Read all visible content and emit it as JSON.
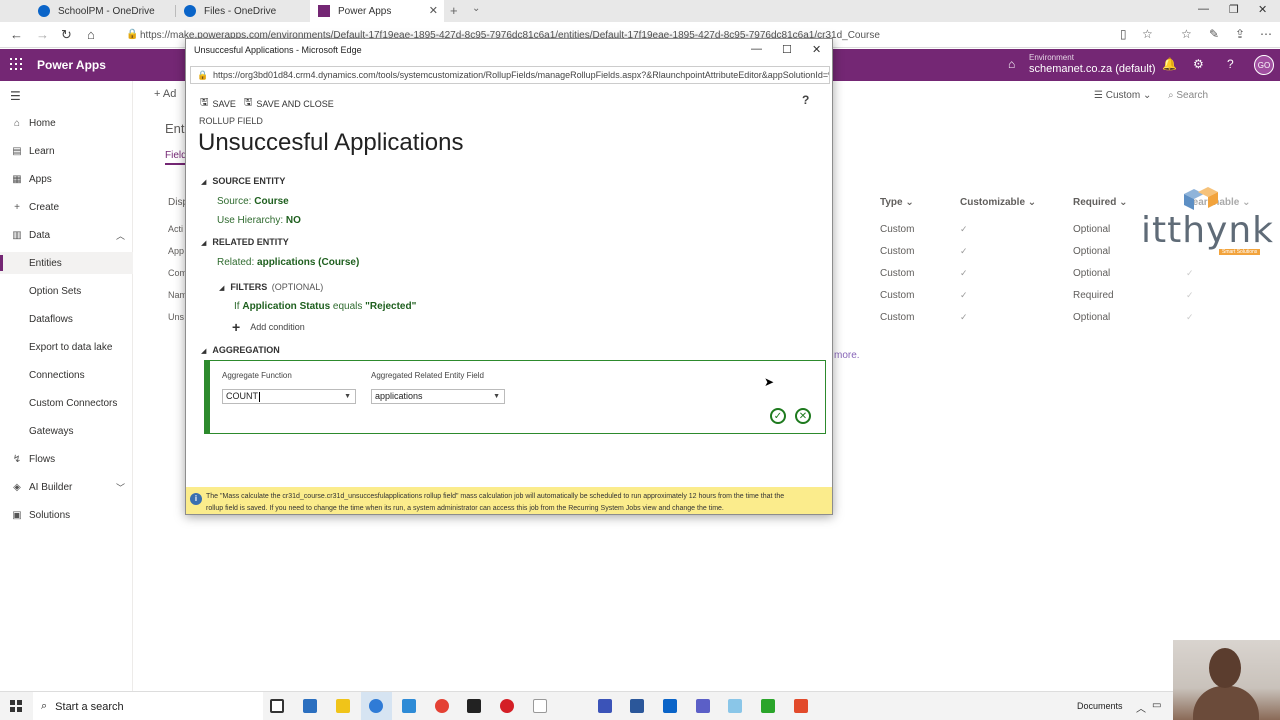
{
  "browser": {
    "tabs": [
      {
        "label": "SchoolPM - OneDrive"
      },
      {
        "label": "Files - OneDrive"
      },
      {
        "label": "Power Apps"
      }
    ],
    "url": "https://make.powerapps.com/environments/Default-17f19eae-1895-427d-8c95-7976dc81c6a1/entities/Default-17f19eae-1895-427d-8c95-7976dc81c6a1/cr31d_Course"
  },
  "header": {
    "app_title": "Power Apps",
    "env_label": "Environment",
    "env_name": "schemanet.co.za (default)",
    "avatar_initials": "GO",
    "accent": "#742774"
  },
  "leftnav": {
    "items": [
      {
        "label": "Home",
        "icon": "home-icon"
      },
      {
        "label": "Learn",
        "icon": "book-icon"
      },
      {
        "label": "Apps",
        "icon": "apps-icon"
      },
      {
        "label": "Create",
        "icon": "plus-icon"
      },
      {
        "label": "Data",
        "icon": "database-icon"
      },
      {
        "label": "Entities"
      },
      {
        "label": "Option Sets"
      },
      {
        "label": "Dataflows"
      },
      {
        "label": "Export to data lake"
      },
      {
        "label": "Connections"
      },
      {
        "label": "Custom Connectors"
      },
      {
        "label": "Gateways"
      },
      {
        "label": "Flows",
        "icon": "flow-icon"
      },
      {
        "label": "AI Builder",
        "icon": "ai-icon"
      },
      {
        "label": "Solutions",
        "icon": "solutions-icon"
      }
    ]
  },
  "background": {
    "cmd_add": "Ad",
    "title_prefix": "Enti",
    "tab_fields": "Field",
    "custom_filter": "Custom",
    "search": "Search",
    "col_display": "Disp",
    "columns": [
      "Type",
      "Customizable",
      "Required",
      "Searchable"
    ],
    "row_prefixes": [
      "Acti",
      "App",
      "Com",
      "Nam",
      "Uns"
    ],
    "rows": [
      {
        "type": "Custom",
        "required": "Optional"
      },
      {
        "type": "Custom",
        "required": "Optional"
      },
      {
        "type": "Custom",
        "required": "Optional"
      },
      {
        "type": "Custom",
        "required": "Required"
      },
      {
        "type": "Custom",
        "required": "Optional"
      }
    ],
    "more": "more."
  },
  "logo": {
    "text": "itthynk",
    "tagline": "Smart Solutions"
  },
  "modal": {
    "window_title": "Unsuccesful Applications - Microsoft Edge",
    "url": "https://org3bd01d84.crm4.dynamics.com/tools/systemcustomization/RollupFields/manageRollupFields.aspx?&RlaunchpointAttributeEditor&appSolutionId=%7f",
    "save": "SAVE",
    "save_close": "SAVE AND CLOSE",
    "help": "?",
    "type_label": "ROLLUP FIELD",
    "title": "Unsuccesful Applications",
    "source_section": "SOURCE ENTITY",
    "source_key": "Source:",
    "source_value": "Course",
    "hierarchy_key": "Use Hierarchy:",
    "hierarchy_value": "NO",
    "related_section": "RELATED ENTITY",
    "related_key": "Related:",
    "related_value": "applications (Course)",
    "filters_label": "FILTERS",
    "filters_optional": "(OPTIONAL)",
    "cond_if": "If",
    "cond_field": "Application Status",
    "cond_op": "equals",
    "cond_value": "\"Rejected\"",
    "add_condition": "Add condition",
    "aggregation_section": "AGGREGATION",
    "agg_function_label": "Aggregate Function",
    "agg_function_value": "COUNT",
    "agg_field_label": "Aggregated Related Entity Field",
    "agg_field_value": "applications",
    "notice_line1": "The \"Mass calculate the cr31d_course.cr31d_unsuccesfulapplications rollup field\" mass calculation job will automatically be scheduled to run approximately 12 hours from the time that the",
    "notice_line2": "rollup field is saved. If you need to change the time when its run, a system administrator can access this job from the Recurring System Jobs view and change the time."
  },
  "taskbar": {
    "search_placeholder": "Start a search",
    "documents": "Documents"
  }
}
